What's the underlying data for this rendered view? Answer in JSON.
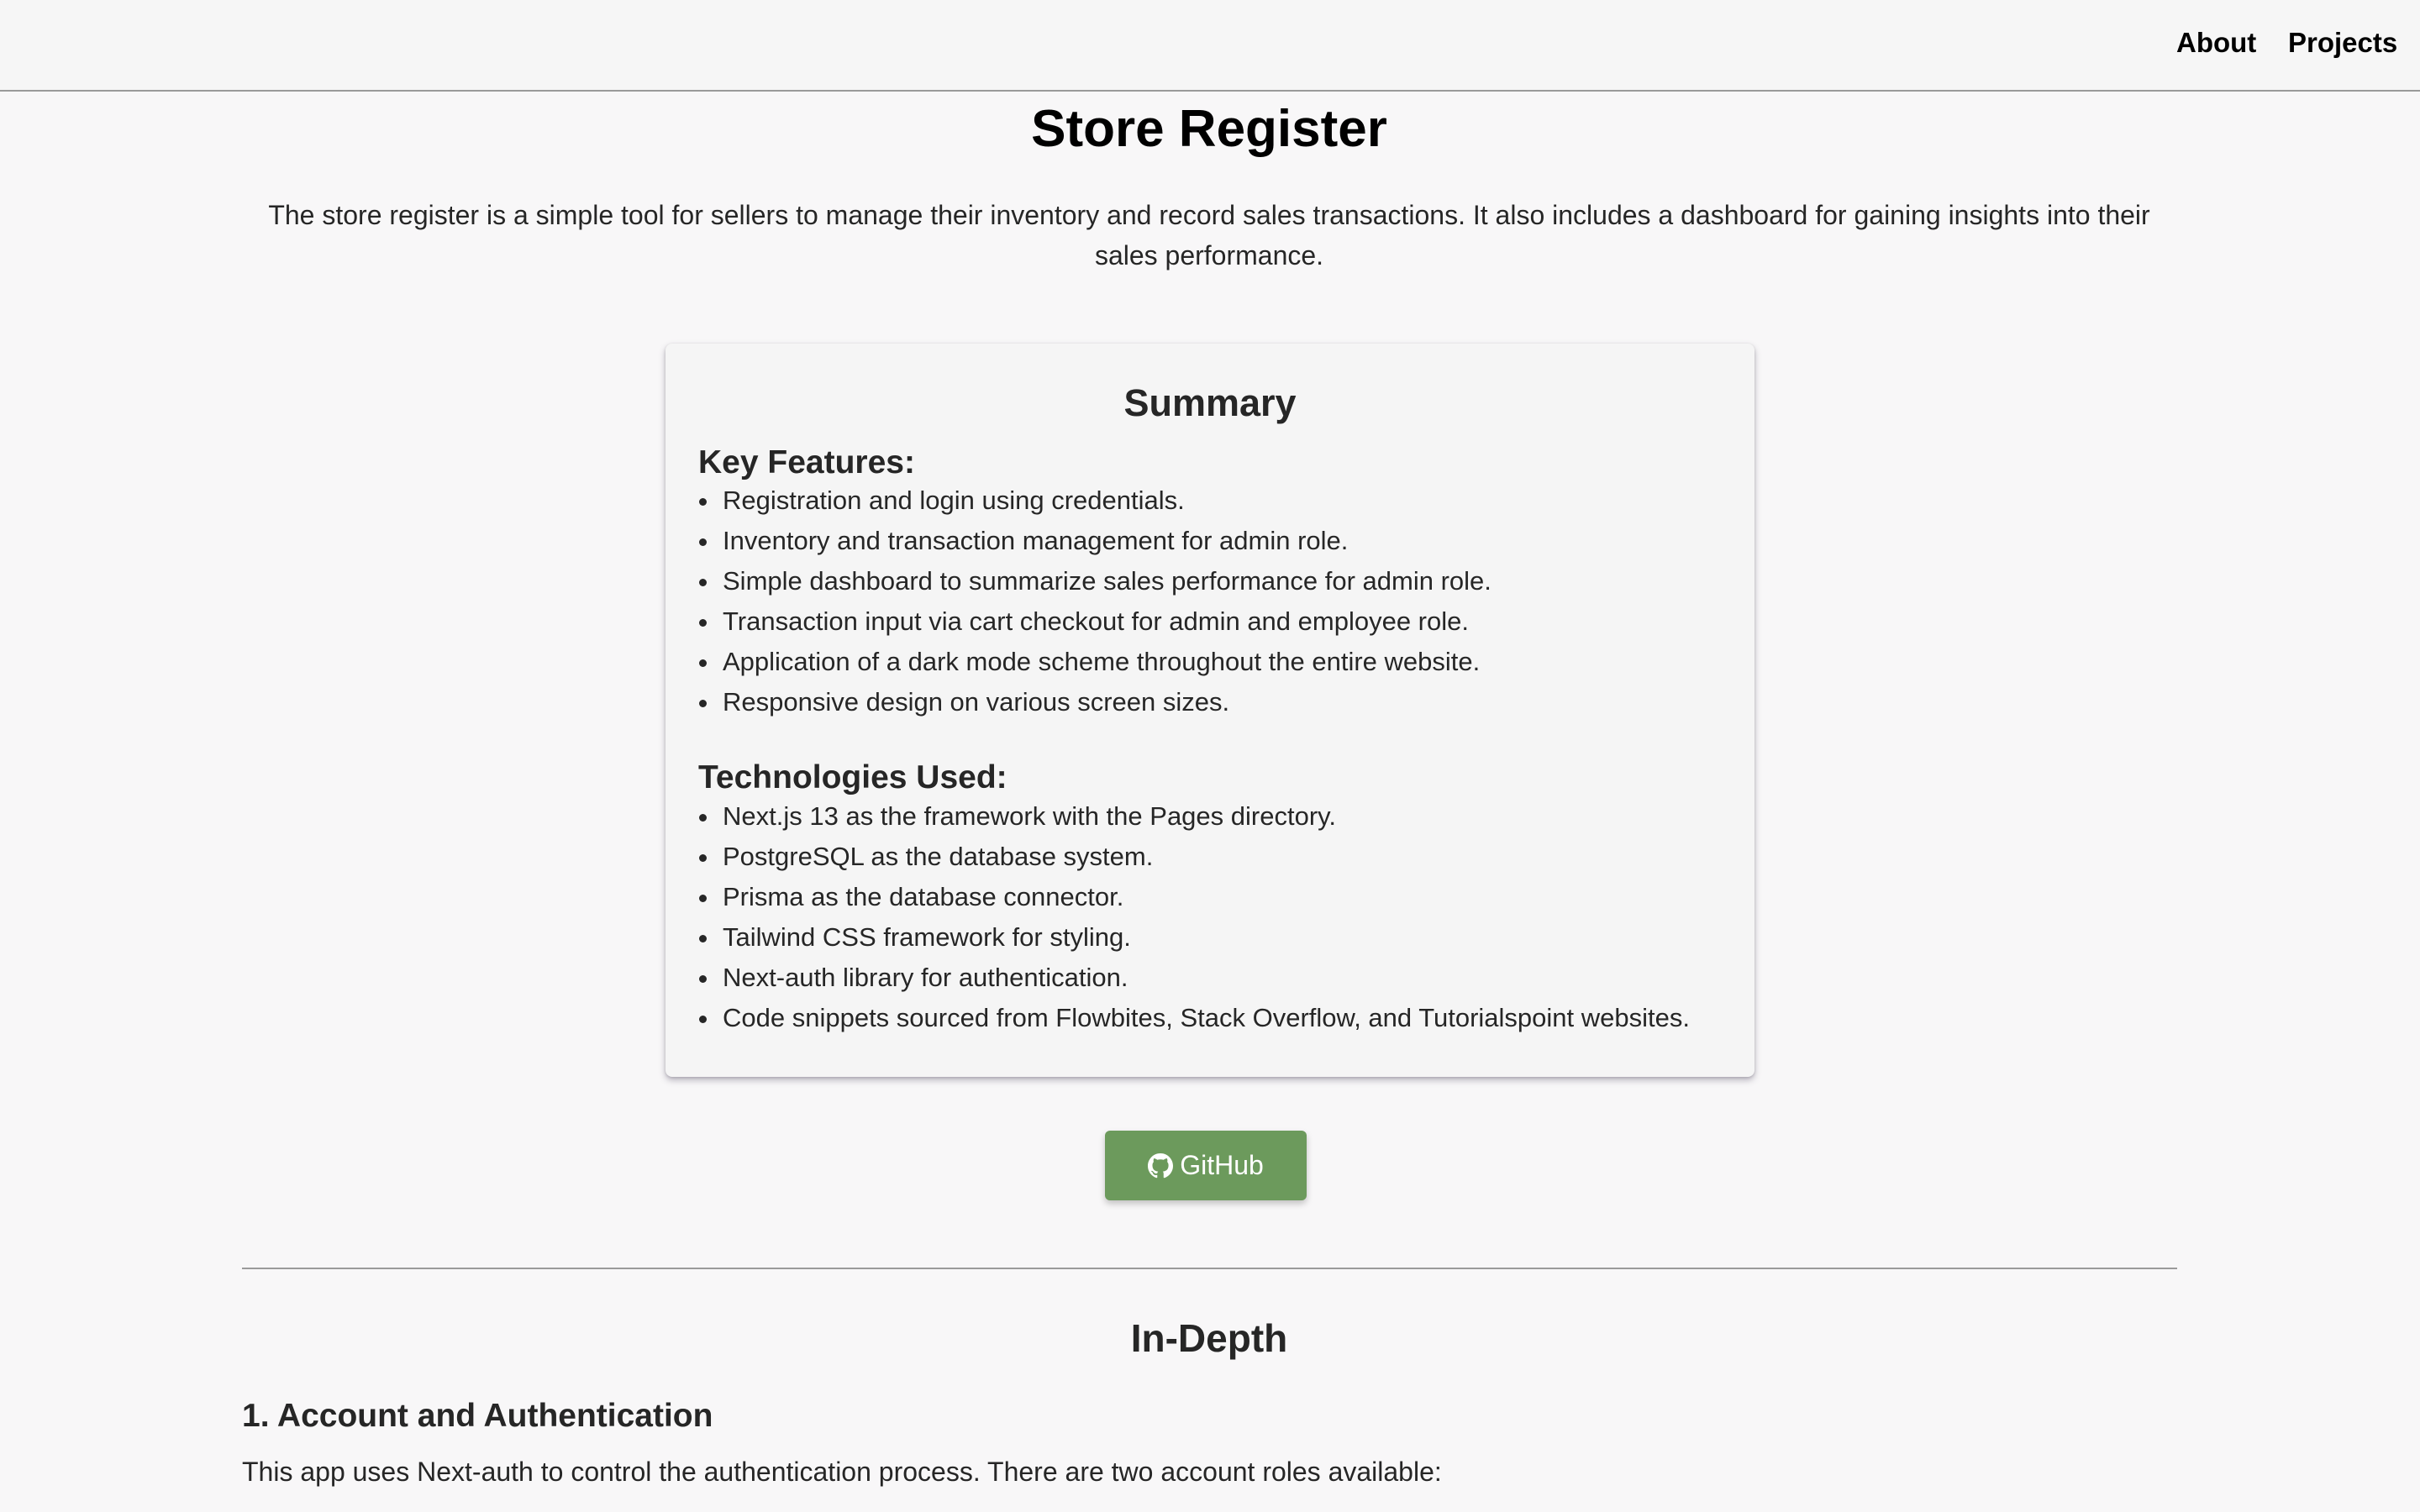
{
  "nav": {
    "about": "About",
    "projects": "Projects"
  },
  "page": {
    "title": "Store Register",
    "intro": "The store register is a simple tool for sellers to manage their inventory and record sales transactions. It also includes a dashboard for gaining insights into their sales performance."
  },
  "summary": {
    "title": "Summary",
    "features_heading": "Key Features:",
    "features": [
      "Registration and login using credentials.",
      "Inventory and transaction management for admin role.",
      "Simple dashboard to summarize sales performance for admin role.",
      "Transaction input via cart checkout for admin and employee role.",
      "Application of a dark mode scheme throughout the entire website.",
      "Responsive design on various screen sizes."
    ],
    "tech_heading": "Technologies Used:",
    "tech": [
      "Next.js 13 as the framework with the Pages directory.",
      "PostgreSQL as the database system.",
      "Prisma as the database connector.",
      "Tailwind CSS framework for styling.",
      "Next-auth library for authentication.",
      "Code snippets sourced from Flowbites, Stack Overflow, and Tutorialspoint websites."
    ]
  },
  "github": {
    "label": "GitHub",
    "icon": "github-icon"
  },
  "in_depth": {
    "title": "In-Depth",
    "section1_heading": "1. Account and Authentication",
    "section1_text": "This app uses Next-auth to control the authentication process. There are two account roles available:"
  },
  "colors": {
    "background": "#f8f7f8",
    "button": "#6c9a5c",
    "text": "#262626"
  }
}
